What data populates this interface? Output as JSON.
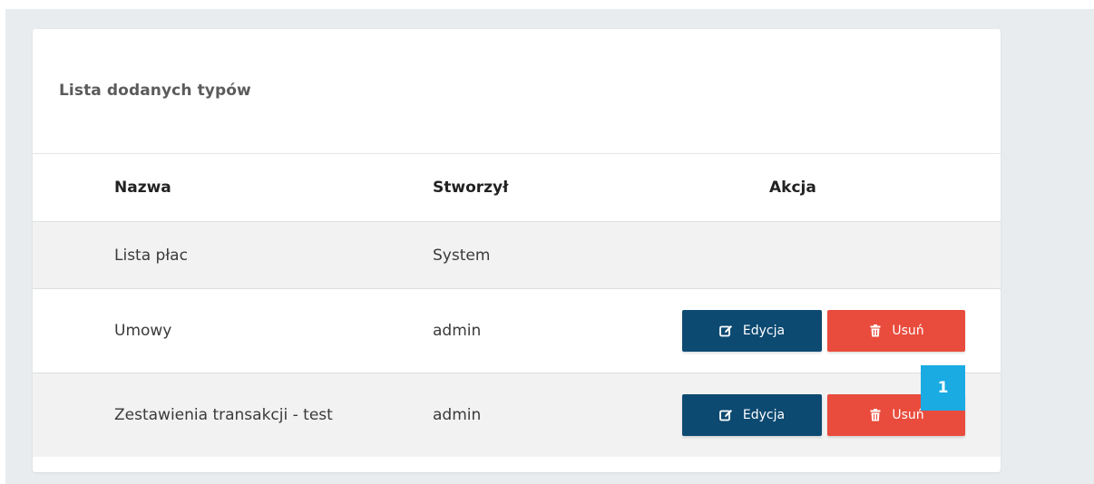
{
  "card": {
    "title": "Lista dodanych typów"
  },
  "table": {
    "columns": [
      "Nazwa",
      "Stworzył",
      "Akcja"
    ],
    "rows": [
      {
        "name": "Lista płac",
        "creator": "System",
        "actions": []
      },
      {
        "name": "Umowy",
        "creator": "admin",
        "actions": [
          "Edycja",
          "Usuń"
        ]
      },
      {
        "name": "Zestawienia transakcji - test",
        "creator": "admin",
        "actions": [
          "Edycja",
          "Usuń"
        ]
      }
    ]
  },
  "buttons": {
    "edit_label": "Edycja",
    "delete_label": "Usuń",
    "edit_icon": "edit-icon",
    "delete_icon": "trash-icon",
    "edit_color": "#0d4a72",
    "delete_color": "#e94c3d"
  },
  "badge": {
    "label": "1",
    "color": "#1aabe3"
  }
}
